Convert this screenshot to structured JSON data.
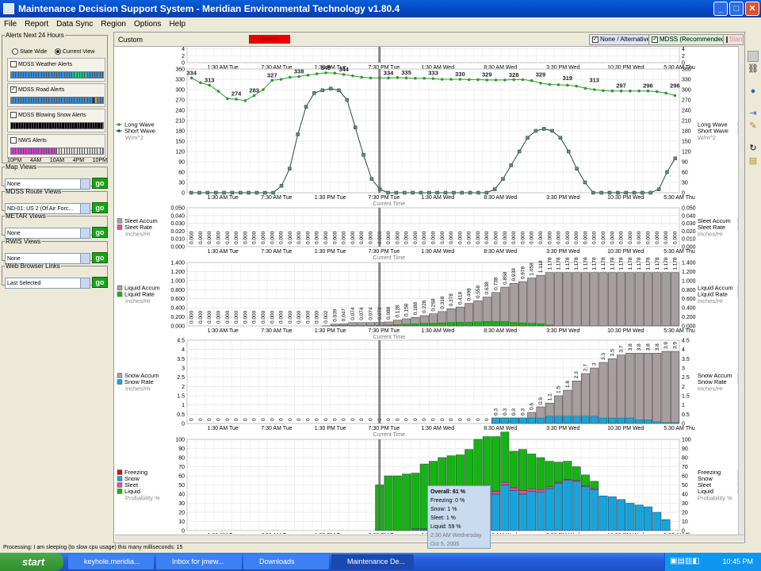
{
  "window": {
    "title": "Maintenance Decision Support System - Meridian Environmental Technology v1.80.4"
  },
  "menu": [
    "File",
    "Report",
    "Data Sync",
    "Region",
    "Options",
    "Help"
  ],
  "left": {
    "alerts_legend": "Alerts Next 24 Hours",
    "state_wide": "State Wide",
    "current_view": "Current View",
    "alerts": [
      {
        "label": "MDSS Weather Alerts",
        "checked": false,
        "colors": [
          "#2e8bdf",
          "#2e8bdf",
          "#2e8bdf",
          "#2e8bdf",
          "#2e8bdf",
          "#2e8bdf",
          "#2e8bdf",
          "#2e8bdf",
          "#2e8bdf",
          "#2e8bdf",
          "#2e8bdf",
          "#2e8bdf",
          "#2e8bdf",
          "#2e8bdf",
          "#2e8bdf",
          "#2e8bdf",
          "#2e8bdf",
          "#2e8bdf",
          "#2e8bdf",
          "#2e8bdf",
          "#2e8bdf",
          "#2e8bdf",
          "#2e8bdf",
          "#2e8bdf",
          "#12c48a",
          "#12c48a",
          "#12c48a",
          "#12c48a",
          "#12c48a",
          "#12c48a",
          "#2e8bdf",
          "#2e8bdf",
          "#2e8bdf",
          "#2e8bdf",
          "#2e8bdf",
          "#2e8bdf"
        ]
      },
      {
        "label": "MDSS Road Alerts",
        "checked": true,
        "colors": [
          "#2e8bdf",
          "#2e8bdf",
          "#2e8bdf",
          "#2e8bdf",
          "#2e8bdf",
          "#2e8bdf",
          "#2e8bdf",
          "#2e8bdf",
          "#2e8bdf",
          "#2e8bdf",
          "#2e8bdf",
          "#2e8bdf",
          "#2e8bdf",
          "#2e8bdf",
          "#2e8bdf",
          "#2e8bdf",
          "#2e8bdf",
          "#2e8bdf",
          "#2e8bdf",
          "#2e8bdf",
          "#2e8bdf",
          "#2e8bdf",
          "#2e8bdf",
          "#2e8bdf",
          "#2e8bdf",
          "#2e8bdf",
          "#2e8bdf",
          "#2e8bdf",
          "#2e8bdf",
          "#2e8bdf",
          "#2e8bdf",
          "#2e8bdf",
          "#0f2c82",
          "#e0b012",
          "#2e8bdf",
          "#2e8bdf"
        ]
      },
      {
        "label": "MDSS Blowing Snow Alerts",
        "checked": false,
        "colors": [
          "#000000",
          "#000000",
          "#000000",
          "#000000",
          "#000000",
          "#000000",
          "#000000",
          "#000000",
          "#000000",
          "#000000",
          "#000000",
          "#000000",
          "#000000",
          "#000000",
          "#000000",
          "#000000",
          "#000000",
          "#000000",
          "#000000",
          "#000000",
          "#000000",
          "#000000",
          "#000000",
          "#000000",
          "#000000",
          "#000000",
          "#000000",
          "#000000",
          "#000000",
          "#000000",
          "#000000",
          "#000000",
          "#000000",
          "#000000",
          "#000000",
          "#000000"
        ]
      },
      {
        "label": "NWS Alerts",
        "checked": false,
        "colors": [
          "#d63dd6",
          "#d63dd6",
          "#d63dd6",
          "#d63dd6",
          "#d63dd6",
          "#d63dd6",
          "#d63dd6",
          "#d63dd6",
          "#d63dd6",
          "#d63dd6",
          "#d63dd6",
          "#d63dd6",
          "#d63dd6",
          "#d63dd6",
          "#d63dd6",
          "#d63dd6",
          "#d63dd6",
          "#d63dd6",
          "#e0e0e0",
          "#e0e0e0",
          "#e0e0e0",
          "#e0e0e0",
          "#e0e0e0",
          "#e0e0e0",
          "#e0e0e0",
          "#e0e0e0",
          "#e0e0e0",
          "#e0e0e0",
          "#e0e0e0",
          "#e0e0e0",
          "#e0e0e0",
          "#e0e0e0",
          "#e0e0e0",
          "#e0e0e0",
          "#e0e0e0",
          "#e0e0e0"
        ]
      }
    ],
    "alert_times": [
      "10PM",
      "4AM",
      "10AM",
      "4PM",
      "10PM"
    ],
    "panels": [
      {
        "legend": "Map Views",
        "value": "None",
        "go": "go"
      },
      {
        "legend": "MDSS Route Views",
        "value": "ND-01: US 2 (Of Air Forc...",
        "go": "go"
      },
      {
        "legend": "METAR Views",
        "value": "None",
        "go": "go"
      },
      {
        "legend": "RWIS Views",
        "value": "None",
        "go": "go"
      },
      {
        "legend": "Web Browser Links",
        "value": "Last Selected",
        "go": "go"
      }
    ]
  },
  "toolbar": {
    "custom": "Custom",
    "refresh": "Refresh",
    "none_alt": "None / Alternative",
    "mdss": "MDSS (Recommended)",
    "standard": "Standard"
  },
  "status": "Processing: I am sleeping (to slow cpu usage) this many milliseconds: 15",
  "taskbar": {
    "start": "start",
    "tasks": [
      "keyhole.meridia...",
      "Inbox for jmew...",
      "Downloads",
      "Maintenance De..."
    ],
    "clock": "10:45 PM"
  },
  "tooltip": {
    "overall": "Overall: 61 %",
    "freezing": "Freezing: 0 %",
    "snow": "Snow: 1 %",
    "sleet": "Sleet: 1 %",
    "liquid": "Liquid: 59 %",
    "time": "2:30 AM Wednesday",
    "date": "Oct 5, 2005"
  },
  "chart_data": {
    "type": "composite",
    "x_tick_labels": [
      "1:30 AM Tue",
      "7:30 AM Tue",
      "1:30 PM Tue",
      "7:30 PM Tue",
      "1:30 AM Wed",
      "8:30 AM Wed",
      "3:30 PM Wed",
      "10:30 PM Wed",
      "5:30 AM Thu"
    ],
    "current_time_label": "Current Time",
    "current_index": 21,
    "panels": [
      {
        "type": "line",
        "legend": [],
        "ylim": [
          0,
          8
        ],
        "yticks": [
          0,
          2,
          4,
          6,
          8
        ]
      },
      {
        "type": "line",
        "legend": [
          "Long Wave",
          "Short Wave"
        ],
        "unit": "W/m^2",
        "ylim": [
          0,
          360
        ],
        "yticks": [
          0,
          30,
          60,
          90,
          120,
          150,
          180,
          210,
          240,
          270,
          300,
          330,
          360
        ],
        "series": [
          {
            "name": "Long Wave",
            "color": "#2f9a2f",
            "values": [
              334,
              320,
              313,
              295,
              274,
              272,
              268,
              283,
              300,
              327,
              330,
              336,
              338,
              342,
              346,
              349,
              348,
              344,
              340,
              336,
              334,
              334,
              334,
              335,
              334,
              333,
              333,
              332,
              330,
              330,
              330,
              329,
              329,
              328,
              328,
              328,
              329,
              329,
              326,
              319,
              315,
              314,
              313,
              310,
              304,
              300,
              297,
              296,
              296,
              296,
              296,
              296,
              294,
              290,
              283
            ]
          },
          {
            "name": "Short Wave",
            "color": "#2b4a3a",
            "values": [
              0,
              0,
              0,
              0,
              0,
              0,
              0,
              0,
              0,
              0,
              0,
              20,
              70,
              170,
              250,
              290,
              298,
              303,
              298,
              270,
              190,
              110,
              40,
              10,
              0,
              0,
              0,
              0,
              0,
              0,
              0,
              0,
              0,
              0,
              0,
              0,
              0,
              10,
              40,
              80,
              120,
              160,
              180,
              186,
              180,
              160,
              120,
              70,
              30,
              0,
              0,
              0,
              0,
              0,
              0,
              0,
              0,
              10,
              60,
              100
            ]
          }
        ],
        "labels": [
          {
            "i": 0,
            "v": 334
          },
          {
            "i": 2,
            "v": 313
          },
          {
            "i": 5,
            "v": 274
          },
          {
            "i": 7,
            "v": 283
          },
          {
            "i": 9,
            "v": 327
          },
          {
            "i": 12,
            "v": 338
          },
          {
            "i": 15,
            "v": 349
          },
          {
            "i": 17,
            "v": 344
          },
          {
            "i": 22,
            "v": 334
          },
          {
            "i": 24,
            "v": 335
          },
          {
            "i": 27,
            "v": 333
          },
          {
            "i": 30,
            "v": 330
          },
          {
            "i": 33,
            "v": 329
          },
          {
            "i": 36,
            "v": 328
          },
          {
            "i": 39,
            "v": 329
          },
          {
            "i": 42,
            "v": 319
          },
          {
            "i": 45,
            "v": 313
          },
          {
            "i": 48,
            "v": 297
          },
          {
            "i": 51,
            "v": 296
          },
          {
            "i": 54,
            "v": 296
          }
        ]
      },
      {
        "type": "bar",
        "legend": [
          "Sleet Accum",
          "Sleet Rate"
        ],
        "unit": "Inches/Hr",
        "ylim": [
          0,
          0.05
        ],
        "yticks": [
          "0.000",
          "0.010",
          "0.020",
          "0.030",
          "0.040",
          "0.050"
        ],
        "values": [
          0,
          0,
          0,
          0,
          0,
          0,
          0,
          0,
          0,
          0,
          0,
          0,
          0,
          0,
          0,
          0,
          0,
          0,
          0,
          0,
          0,
          0,
          0,
          0,
          0,
          0,
          0,
          0,
          0,
          0,
          0,
          0,
          0,
          0,
          0,
          0,
          0,
          0,
          0,
          0,
          0,
          0,
          0,
          0,
          0,
          0,
          0,
          0,
          0,
          0,
          0,
          0,
          0,
          0,
          0
        ]
      },
      {
        "type": "bar",
        "legend": [
          "Liquid Accum",
          "Liquid Rate"
        ],
        "unit": "Inches/Hr",
        "ylim": [
          0,
          1.4
        ],
        "yticks": [
          "0.000",
          "0.200",
          "0.400",
          "0.600",
          "0.800",
          "1.000",
          "1.200",
          "1.400"
        ],
        "labels": [
          "0.000",
          "0.000",
          "0.000",
          "0.000",
          "0.000",
          "0.000",
          "0.000",
          "0.000",
          "0.000",
          "0.000",
          "0.000",
          "0.000",
          "0.000",
          "0.000",
          "0.000",
          "0.002",
          "0.039",
          "0.047",
          "0.074",
          "0.074",
          "0.074",
          "0.078",
          "0.088",
          "0.128",
          "0.158",
          "0.188",
          "0.228",
          "0.268",
          "0.318",
          "0.378",
          "0.418",
          "0.498",
          "0.558",
          "0.638",
          "0.738",
          "0.858",
          "0.938",
          "0.978",
          "1.058",
          "1.118",
          "1.178",
          "1.178",
          "1.178",
          "1.178",
          "1.178",
          "1.178",
          "1.178",
          "1.178",
          "1.178",
          "1.178",
          "1.178",
          "1.178",
          "1.178",
          "1.178",
          "1.178"
        ],
        "rate": [
          0,
          0,
          0,
          0,
          0,
          0,
          0,
          0,
          0,
          0,
          0,
          0,
          0,
          0,
          0,
          0.002,
          0.005,
          0.005,
          0.005,
          0.005,
          0.005,
          0.01,
          0.02,
          0.03,
          0.04,
          0.05,
          0.06,
          0.06,
          0.07,
          0.08,
          0.08,
          0.08,
          0.09,
          0.1,
          0.1,
          0.1,
          0.08,
          0.07,
          0.06,
          0.05,
          0.02,
          0,
          0,
          0,
          0,
          0,
          0,
          0,
          0,
          0,
          0,
          0,
          0,
          0,
          0
        ]
      },
      {
        "type": "bar",
        "legend": [
          "Snow Accum",
          "Snow Rate"
        ],
        "unit": "Inches/Hr",
        "ylim": [
          0,
          4.5
        ],
        "yticks": [
          "0",
          "0.5",
          "1",
          "1.5",
          "2",
          "2.5",
          "3",
          "3.5",
          "4",
          "4.5"
        ],
        "labels": [
          "0",
          "0",
          "0",
          "0",
          "0",
          "0",
          "0",
          "0",
          "0",
          "0",
          "0",
          "0",
          "0",
          "0",
          "0",
          "0",
          "0",
          "0",
          "0",
          "0",
          "0",
          "0",
          "0",
          "0",
          "0",
          "0",
          "0",
          "0",
          "0",
          "0",
          "0",
          "0",
          "0",
          "0",
          "0.3",
          "0.3",
          "0.3",
          "0.3",
          "0.6",
          "0.9",
          "1.1",
          "1.5",
          "1.8",
          "2.3",
          "2.7",
          "3",
          "3.3",
          "3.5",
          "3.7",
          "3.8",
          "3.8",
          "3.8",
          "3.8",
          "3.9",
          "3.9"
        ],
        "rate": [
          0,
          0,
          0,
          0,
          0,
          0,
          0,
          0,
          0,
          0,
          0,
          0,
          0,
          0,
          0,
          0,
          0,
          0,
          0,
          0,
          0,
          0,
          0,
          0,
          0,
          0,
          0,
          0,
          0,
          0,
          0,
          0,
          0,
          0,
          0.3,
          0.3,
          0.3,
          0.3,
          0.3,
          0.3,
          0.4,
          0.4,
          0.4,
          0.4,
          0.4,
          0.4,
          0.3,
          0.3,
          0.3,
          0.3,
          0.2,
          0.2,
          0.1,
          0.05,
          0.05
        ]
      },
      {
        "type": "stacked-bar",
        "legend": [
          "Freezing",
          "Snow",
          "Sleet",
          "Liquid"
        ],
        "unit": "Probability %",
        "ylim": [
          0,
          100
        ],
        "yticks": [
          0,
          10,
          20,
          30,
          40,
          50,
          60,
          70,
          80,
          90,
          100
        ],
        "liquid": [
          0,
          0,
          0,
          0,
          0,
          0,
          0,
          0,
          0,
          0,
          0,
          0,
          0,
          0,
          0,
          0,
          0,
          0,
          0,
          0,
          0,
          50,
          60,
          60,
          62,
          61,
          71,
          74,
          78,
          80,
          80,
          78,
          70,
          65,
          60,
          55,
          40,
          45,
          38,
          35,
          28,
          22,
          20,
          15,
          12,
          8,
          0,
          0,
          0,
          0,
          0,
          0,
          0,
          0,
          0
        ],
        "snow": [
          0,
          0,
          0,
          0,
          0,
          0,
          0,
          0,
          0,
          0,
          0,
          0,
          0,
          0,
          0,
          0,
          0,
          0,
          0,
          0,
          0,
          0,
          0,
          0,
          0,
          1,
          1,
          1,
          1,
          1,
          2,
          10,
          28,
          36,
          40,
          50,
          44,
          40,
          43,
          42,
          46,
          52,
          55,
          54,
          48,
          45,
          38,
          37,
          34,
          30,
          28,
          26,
          20,
          12,
          0
        ],
        "sleet": [
          0,
          0,
          0,
          0,
          0,
          0,
          0,
          0,
          0,
          0,
          0,
          0,
          0,
          0,
          0,
          0,
          0,
          0,
          0,
          0,
          0,
          0,
          0,
          0,
          0,
          1,
          1,
          1,
          1,
          1,
          1,
          1,
          2,
          2,
          3,
          3,
          3,
          4,
          3,
          3,
          2,
          1,
          1,
          1,
          1,
          1,
          0,
          0,
          0,
          0,
          0,
          0,
          0,
          0,
          0
        ]
      }
    ]
  }
}
